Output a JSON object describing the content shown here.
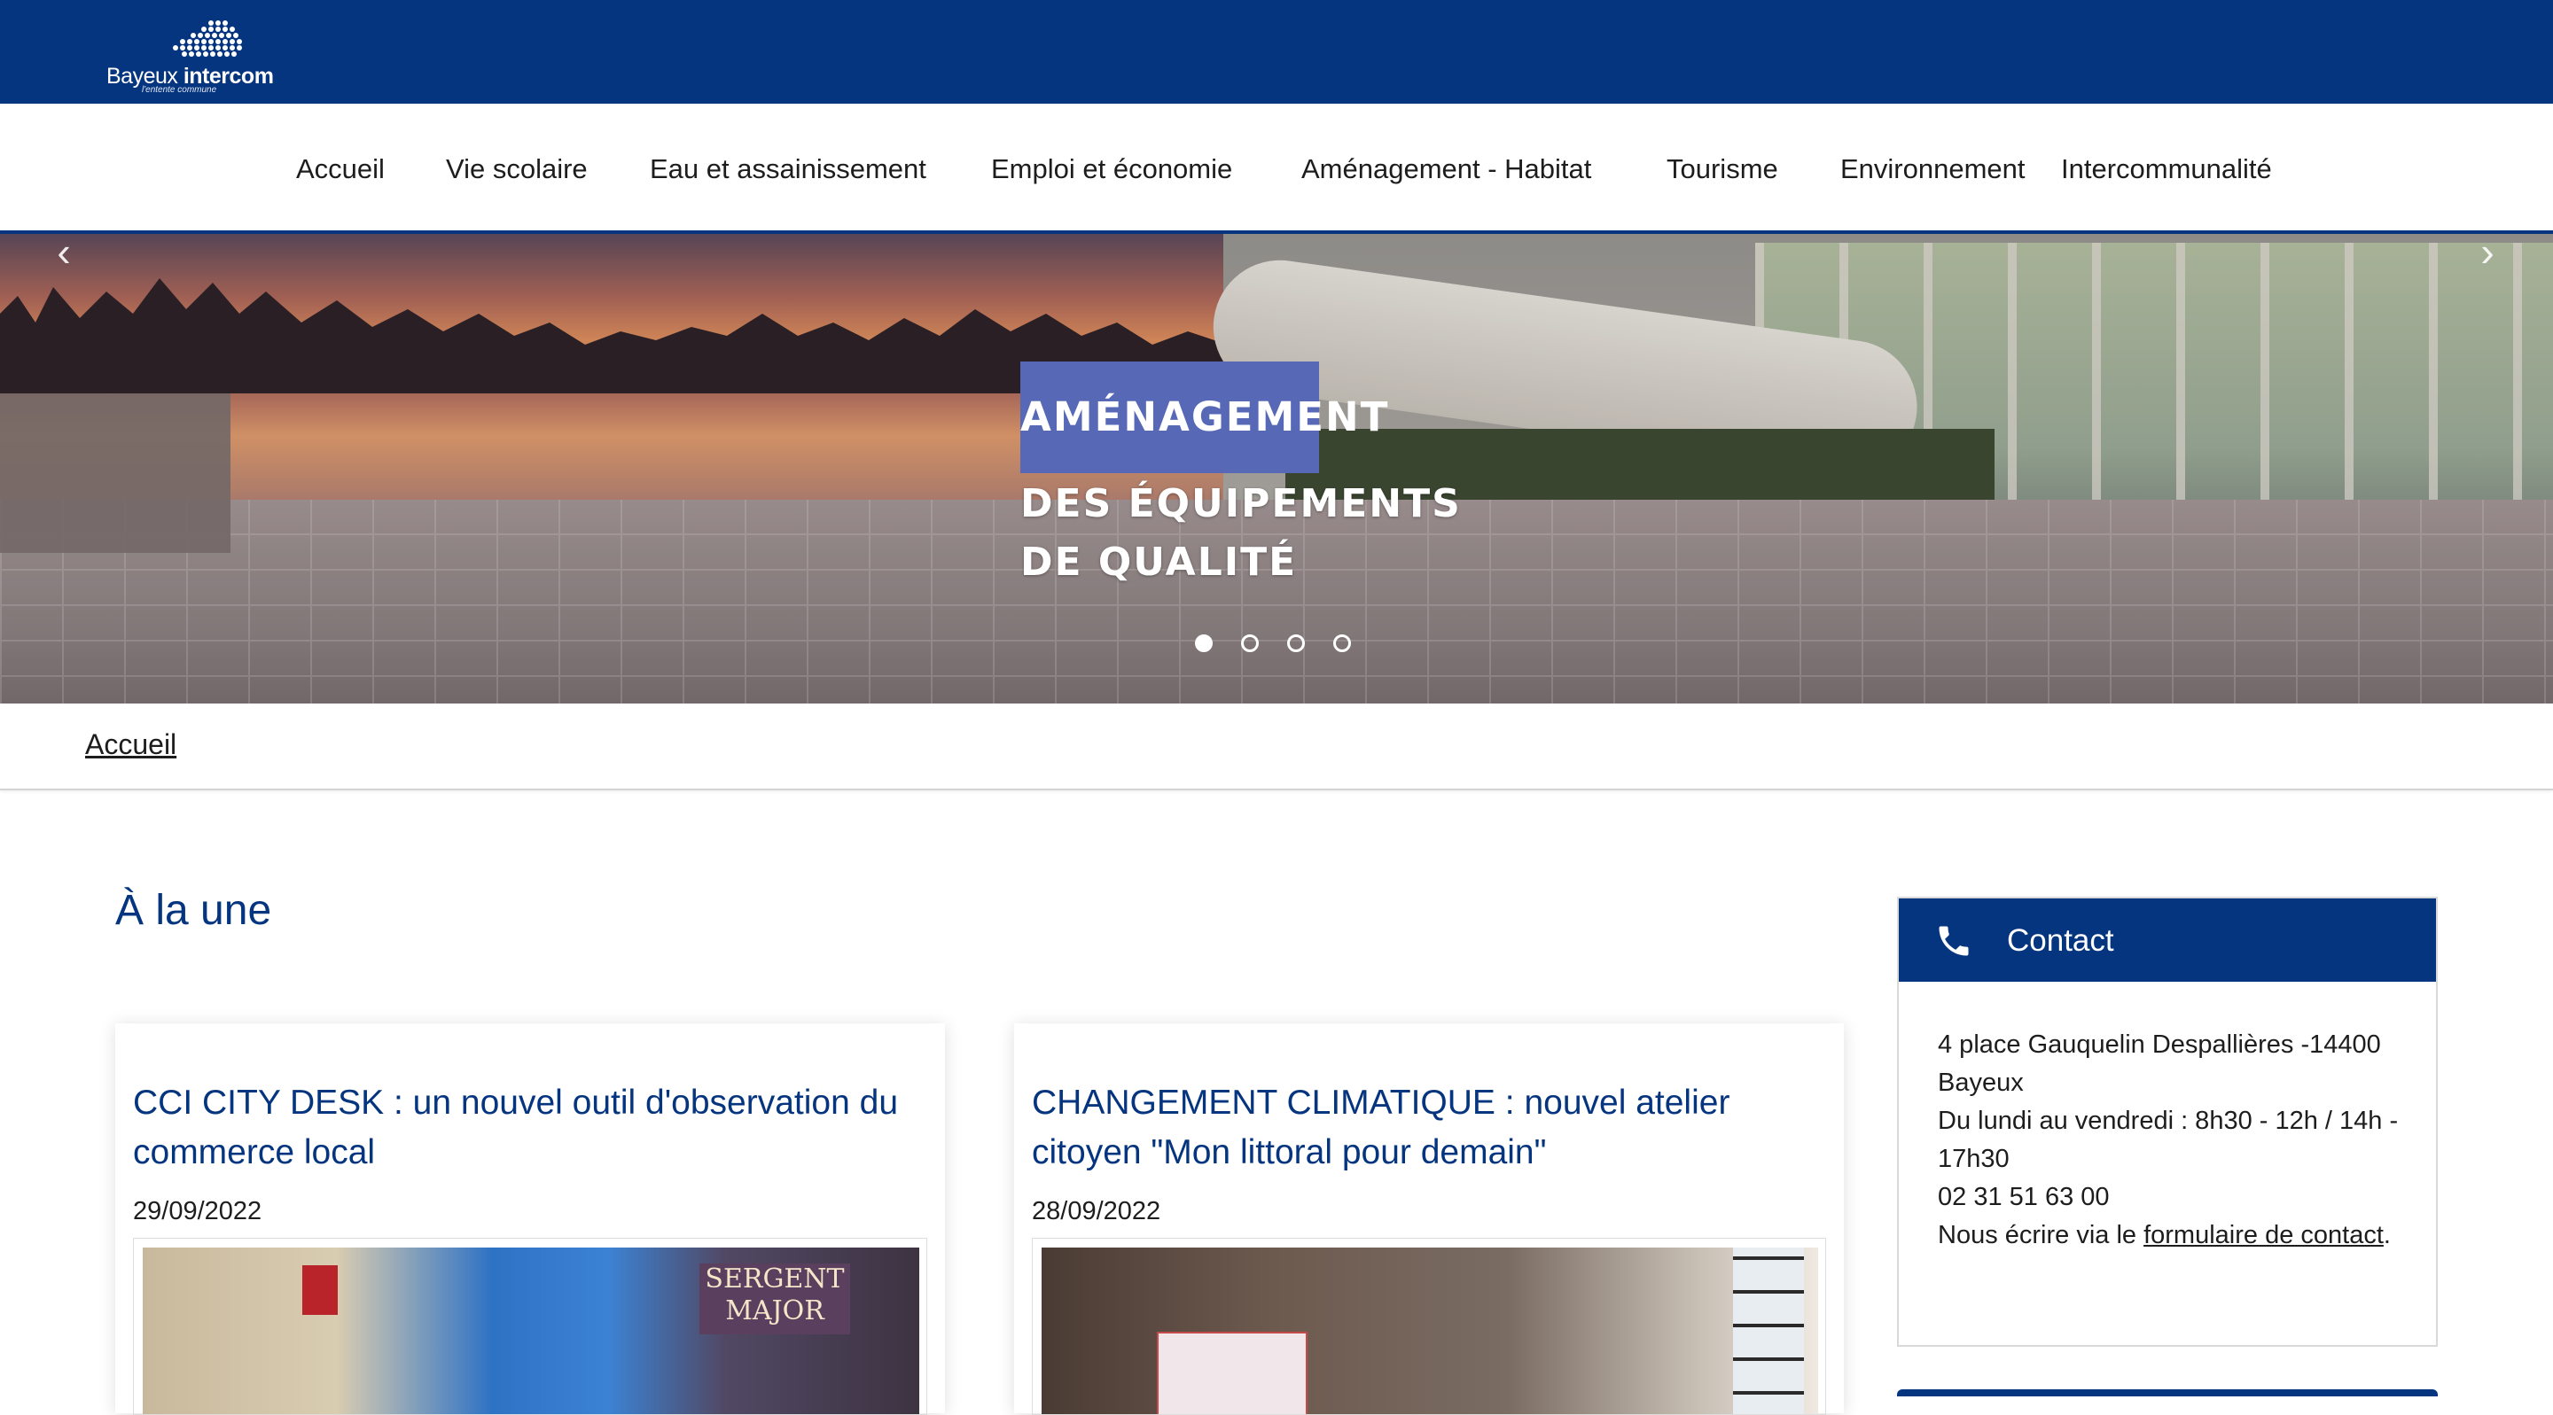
{
  "header": {
    "logo_text_light": "Bayeux",
    "logo_text_bold": "intercom",
    "logo_tagline": "l'entente commune"
  },
  "nav": {
    "items": [
      {
        "label": "Accueil"
      },
      {
        "label": "Vie scolaire"
      },
      {
        "label": "Eau et assainissement"
      },
      {
        "label": "Emploi et économie"
      },
      {
        "label": "Aménagement - Habitat"
      },
      {
        "label": "Tourisme"
      },
      {
        "label": "Environnement"
      },
      {
        "label": "Intercommunalité"
      }
    ]
  },
  "hero": {
    "tag": "AMÉNAGEMENT",
    "subtitle_line1": "DES ÉQUIPEMENTS",
    "subtitle_line2": "DE QUALITÉ",
    "prev_icon": "chevron-left-icon",
    "next_icon": "chevron-right-icon",
    "slide_count": 4,
    "active_slide": 1
  },
  "breadcrumb": {
    "home": "Accueil"
  },
  "news": {
    "section_title": "À la une",
    "cards": [
      {
        "title": "CCI CITY DESK : un nouvel outil d'observation du commerce local",
        "date": "29/09/2022",
        "image_sign": "SERGENT MAJOR"
      },
      {
        "title": "CHANGEMENT CLIMATIQUE : nouvel atelier citoyen \"Mon littoral pour demain\"",
        "date": "28/09/2022"
      }
    ]
  },
  "contact": {
    "title": "Contact",
    "icon": "phone-icon",
    "address": "4 place Gauquelin Despallières -14400 Bayeux",
    "hours": "Du lundi au vendredi : 8h30 - 12h / 14h - 17h30",
    "phone": "02 31 51 63 00",
    "write_prefix": "Nous écrire via le ",
    "write_link": "formulaire de contact",
    "write_suffix": "."
  },
  "colors": {
    "brand_blue": "#06357f",
    "hero_tag_bg": "#5769b6"
  }
}
